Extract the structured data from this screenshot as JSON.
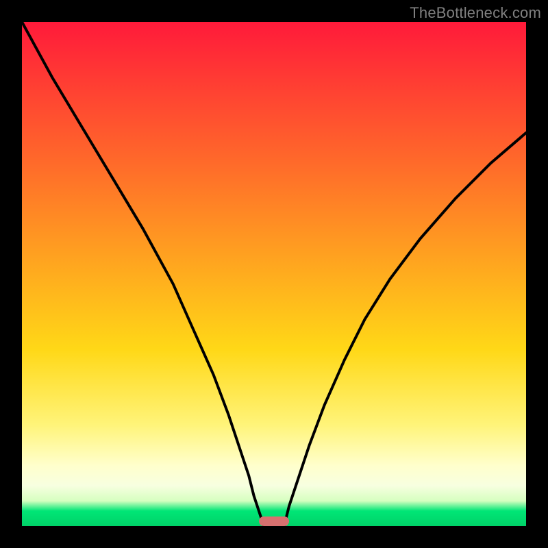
{
  "watermark": "TheBottleneck.com",
  "colors": {
    "frame": "#000000",
    "gradient_top": "#ff1a3a",
    "gradient_mid": "#ffd817",
    "gradient_bottom": "#00d268",
    "curve": "#000000",
    "marker": "#d6706f"
  },
  "chart_data": {
    "type": "line",
    "title": "",
    "xlabel": "",
    "ylabel": "",
    "xlim": [
      0,
      100
    ],
    "ylim": [
      0,
      100
    ],
    "series": [
      {
        "name": "left-curve",
        "x": [
          0,
          6,
          12,
          18,
          24,
          30,
          34,
          38,
          41,
          43,
          45,
          46,
          47,
          48
        ],
        "y": [
          100,
          89,
          79,
          69,
          59,
          48,
          39,
          30,
          22,
          16,
          10,
          6,
          3,
          0
        ]
      },
      {
        "name": "right-curve",
        "x": [
          52,
          53,
          55,
          57,
          60,
          64,
          68,
          73,
          79,
          86,
          93,
          100
        ],
        "y": [
          0,
          4,
          10,
          16,
          24,
          33,
          41,
          49,
          57,
          65,
          72,
          78
        ]
      }
    ],
    "marker": {
      "x_center": 50,
      "y": 0,
      "width_pct": 6
    }
  }
}
